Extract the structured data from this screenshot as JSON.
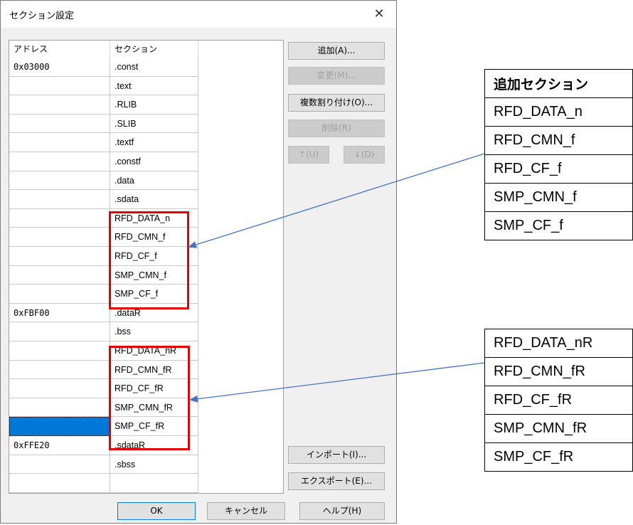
{
  "dialog": {
    "title": "セクション設定",
    "close_glyph": "✕"
  },
  "grid": {
    "columns": [
      "アドレス",
      "セクション"
    ],
    "rows": [
      {
        "address": "0x03000",
        "section": ".const"
      },
      {
        "address": "",
        "section": ".text"
      },
      {
        "address": "",
        "section": ".RLIB"
      },
      {
        "address": "",
        "section": ".SLIB"
      },
      {
        "address": "",
        "section": ".textf"
      },
      {
        "address": "",
        "section": ".constf"
      },
      {
        "address": "",
        "section": ".data"
      },
      {
        "address": "",
        "section": ".sdata"
      },
      {
        "address": "",
        "section": "RFD_DATA_n"
      },
      {
        "address": "",
        "section": "RFD_CMN_f"
      },
      {
        "address": "",
        "section": "RFD_CF_f"
      },
      {
        "address": "",
        "section": "SMP_CMN_f"
      },
      {
        "address": "",
        "section": "SMP_CF_f"
      },
      {
        "address": "0xFBF00",
        "section": ".dataR"
      },
      {
        "address": "",
        "section": ".bss"
      },
      {
        "address": "",
        "section": "RFD_DATA_nR"
      },
      {
        "address": "",
        "section": "RFD_CMN_fR"
      },
      {
        "address": "",
        "section": "RFD_CF_fR"
      },
      {
        "address": "",
        "section": "SMP_CMN_fR"
      },
      {
        "address": "",
        "section": "SMP_CF_fR"
      },
      {
        "address": "0xFFE20",
        "section": ".sdataR"
      },
      {
        "address": "",
        "section": ".sbss"
      },
      {
        "address": "",
        "section": ""
      }
    ]
  },
  "buttons": {
    "add": "追加(A)...",
    "change": "変更(M)...",
    "multi_assign": "複数割り付け(O)...",
    "delete": "削除(R)",
    "up": "↑(U)",
    "down": "↓(D)",
    "import": "インポート(I)...",
    "export": "エクスポート(E)...",
    "ok": "OK",
    "cancel": "キャンセル",
    "help": "ヘルプ(H)"
  },
  "table1": {
    "header": "追加セクション",
    "items": [
      "RFD_DATA_n",
      "RFD_CMN_f",
      "RFD_CF_f",
      "SMP_CMN_f",
      "SMP_CF_f"
    ]
  },
  "table2": {
    "items": [
      "RFD_DATA_nR",
      "RFD_CMN_fR",
      "RFD_CF_fR",
      "SMP_CMN_fR",
      "SMP_CF_fR"
    ]
  },
  "colors": {
    "highlight": "#e00000",
    "selection": "#0078d7",
    "arrow": "#4472c4"
  }
}
